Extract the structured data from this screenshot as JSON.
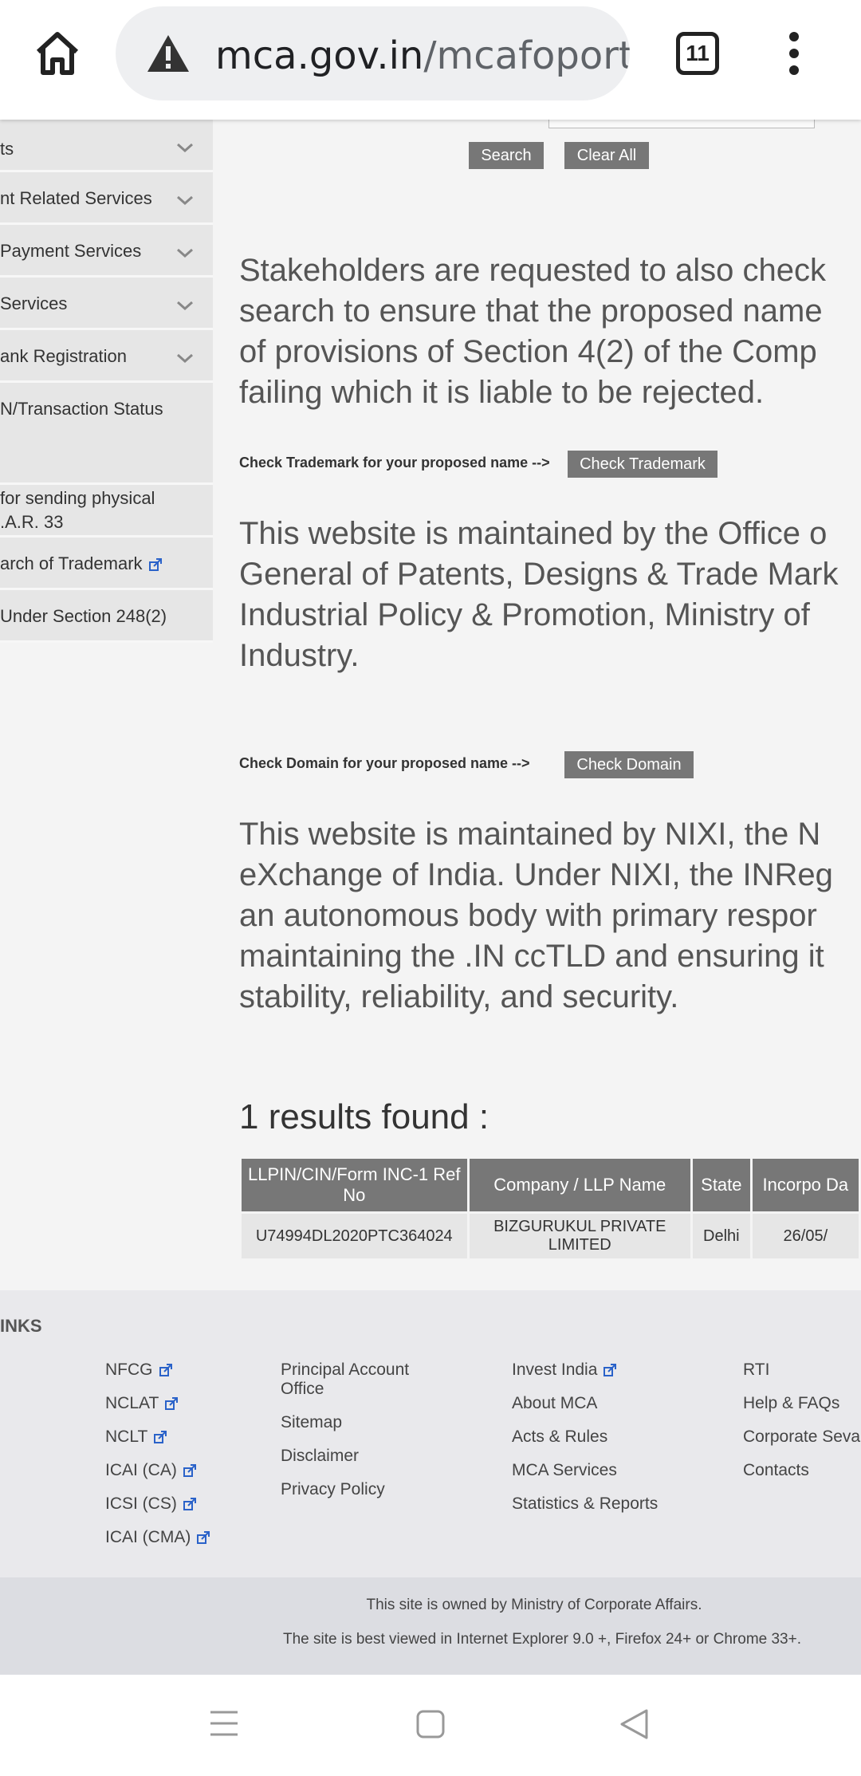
{
  "browser": {
    "url_domain": "mca.gov.in",
    "url_path": "/mcafoporta",
    "tab_count": "11"
  },
  "sidebar": {
    "items": [
      {
        "label": "ts",
        "has_chevron": true
      },
      {
        "label": "nt Related Services",
        "has_chevron": true
      },
      {
        "label": "Payment Services",
        "has_chevron": true
      },
      {
        "label": "Services",
        "has_chevron": true
      },
      {
        "label": "ank Registration",
        "has_chevron": true
      },
      {
        "label": "N/Transaction Status",
        "has_chevron": false
      },
      {
        "label": "for sending physical\n.A.R. 33",
        "has_chevron": false
      },
      {
        "label": "arch of Trademark",
        "has_chevron": false,
        "external": true
      },
      {
        "label": "Under Section 248(2)",
        "has_chevron": false
      }
    ]
  },
  "search": {
    "search_label": "Search",
    "clear_label": "Clear All"
  },
  "notices": {
    "stakeholders": "Stakeholders are requested to also check\nsearch to ensure that the proposed name\nof provisions of Section 4(2) of the Comp\nfailing which it is liable to be rejected.",
    "trademark_maintained": "This website is maintained by the Office o\nGeneral of Patents, Designs & Trade Mark\nIndustrial Policy & Promotion, Ministry of\nIndustry.",
    "domain_maintained": "This website is maintained by NIXI, the N\neXchange of India. Under NIXI, the INReg\nan autonomous body with primary respor\nmaintaining the .IN ccTLD and ensuring it\nstability, reliability, and security."
  },
  "trademark": {
    "label": "Check Trademark for your proposed name -->",
    "button": "Check Trademark"
  },
  "domain": {
    "label": "Check Domain for your proposed name -->",
    "button": "Check Domain"
  },
  "results": {
    "summary": "1 results found :",
    "headers": [
      "LLPIN/CIN/Form INC-1 Ref No",
      "Company / LLP Name",
      "State",
      "Incorpo Da"
    ],
    "rows": [
      [
        "U74994DL2020PTC364024",
        "BIZGURUKUL PRIVATE LIMITED",
        "Delhi",
        "26/05/"
      ]
    ]
  },
  "footer": {
    "title": "INKS",
    "col1": [
      "NFCG",
      "NCLAT",
      "NCLT",
      "ICAI (CA)",
      "ICSI (CS)",
      "ICAI (CMA)"
    ],
    "col2": [
      "Principal Account Office",
      "Sitemap",
      "Disclaimer",
      "Privacy Policy"
    ],
    "col3": [
      "Invest India",
      "About MCA",
      "Acts & Rules",
      "MCA Services",
      "Statistics & Reports"
    ],
    "col4": [
      "RTI",
      "Help & FAQs",
      "Corporate Seva",
      "Contacts"
    ],
    "owned": "This site is owned by Ministry of Corporate Affairs.",
    "best_viewed": "The site is best viewed in Internet Explorer 9.0 +, Firefox 24+ or Chrome 33+."
  },
  "colors": {
    "button_grey": "#777777",
    "sidebar_bg": "#e6e6e6",
    "footer_bg": "#e9e9ec",
    "link_icon_blue": "#2a62c9"
  }
}
